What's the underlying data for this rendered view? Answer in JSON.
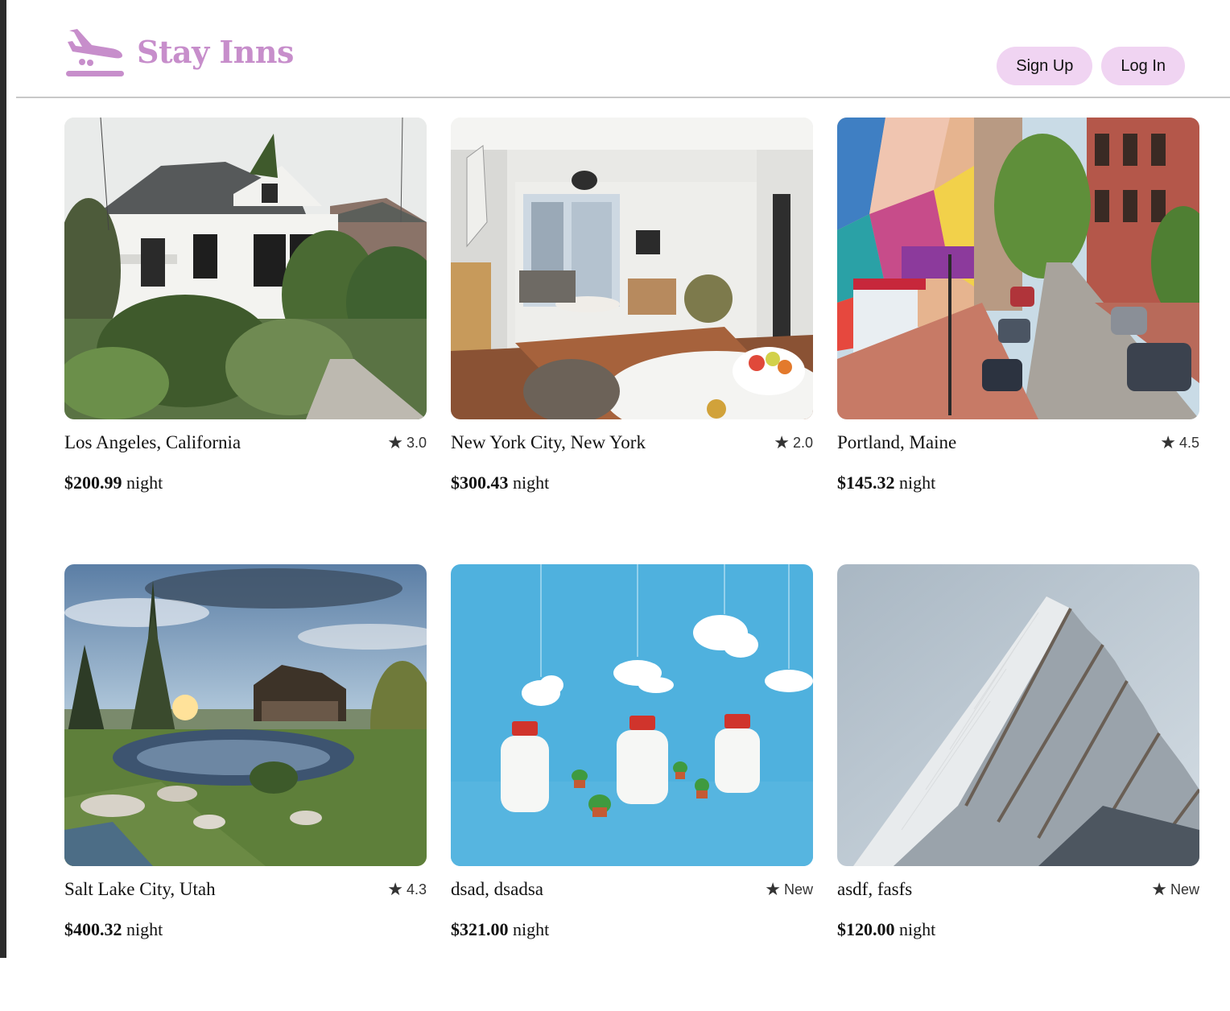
{
  "brand": {
    "name": "Stay Inns",
    "icon": "airplane-landing-icon",
    "color": "#c78ecb"
  },
  "nav": {
    "signup_label": "Sign Up",
    "login_label": "Log In",
    "button_color": "#f0d4f2"
  },
  "listings": [
    {
      "location": "Los Angeles, California",
      "rating": "3.0",
      "price": "$200.99",
      "unit": "night",
      "image": "victorian-house-photo"
    },
    {
      "location": "New York City, New York",
      "rating": "2.0",
      "price": "$300.43",
      "unit": "night",
      "image": "apartment-interior-photo"
    },
    {
      "location": "Portland, Maine",
      "rating": "4.5",
      "price": "$145.32",
      "unit": "night",
      "image": "city-street-mural-photo"
    },
    {
      "location": "Salt Lake City, Utah",
      "rating": "4.3",
      "price": "$400.32",
      "unit": "night",
      "image": "lodge-pond-sunset-photo"
    },
    {
      "location": "dsad, dsadsa",
      "rating": "New",
      "price": "$321.00",
      "unit": "night",
      "image": "milk-bottles-clouds-photo"
    },
    {
      "location": "asdf, fasfs",
      "rating": "New",
      "price": "$120.00",
      "unit": "night",
      "image": "modern-skyscraper-photo"
    }
  ]
}
